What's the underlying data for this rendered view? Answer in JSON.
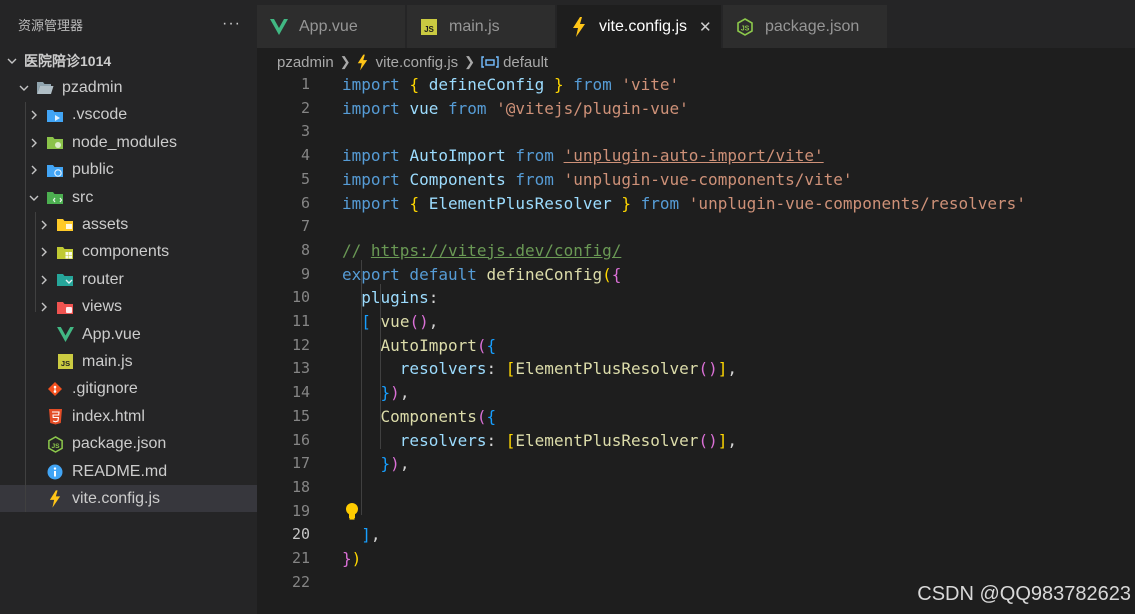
{
  "explorer": {
    "title": "资源管理器",
    "more": "···",
    "tree": [
      {
        "label": "医院陪诊1014",
        "type": "root",
        "chevron": "down",
        "indent": 0
      },
      {
        "label": "pzadmin",
        "type": "folder-open",
        "chevron": "down",
        "indent": 1
      },
      {
        "label": ".vscode",
        "type": "vscode",
        "chevron": "right",
        "indent": 2
      },
      {
        "label": "node_modules",
        "type": "node",
        "chevron": "right",
        "indent": 2
      },
      {
        "label": "public",
        "type": "public",
        "chevron": "right",
        "indent": 2
      },
      {
        "label": "src",
        "type": "src",
        "chevron": "down",
        "indent": 2
      },
      {
        "label": "assets",
        "type": "assets",
        "chevron": "right",
        "indent": 3
      },
      {
        "label": "components",
        "type": "components",
        "chevron": "right",
        "indent": 3
      },
      {
        "label": "router",
        "type": "router",
        "chevron": "right",
        "indent": 3
      },
      {
        "label": "views",
        "type": "views",
        "chevron": "right",
        "indent": 3
      },
      {
        "label": "App.vue",
        "type": "vue",
        "chevron": "",
        "indent": 3
      },
      {
        "label": "main.js",
        "type": "js",
        "chevron": "",
        "indent": 3
      },
      {
        "label": ".gitignore",
        "type": "git",
        "chevron": "",
        "indent": 2
      },
      {
        "label": "index.html",
        "type": "html",
        "chevron": "",
        "indent": 2
      },
      {
        "label": "package.json",
        "type": "json",
        "chevron": "",
        "indent": 2
      },
      {
        "label": "README.md",
        "type": "info",
        "chevron": "",
        "indent": 2
      },
      {
        "label": "vite.config.js",
        "type": "vite",
        "chevron": "",
        "indent": 2,
        "selected": true
      }
    ]
  },
  "tabs": [
    {
      "label": "App.vue",
      "icon": "vue-icon",
      "active": false
    },
    {
      "label": "main.js",
      "icon": "js-icon",
      "active": false
    },
    {
      "label": "vite.config.js",
      "icon": "vite-icon",
      "active": true,
      "close": "✕"
    },
    {
      "label": "package.json",
      "icon": "json-icon",
      "active": false
    }
  ],
  "breadcrumb": {
    "folder": "pzadmin",
    "file": "vite.config.js",
    "symbol": "default"
  },
  "editor": {
    "current_line": 20,
    "lines": [
      {
        "n": 1,
        "tokens": [
          [
            "kw",
            "import "
          ],
          [
            "b1",
            "{ "
          ],
          [
            "id",
            "defineConfig "
          ],
          [
            "b1",
            "}"
          ],
          [
            "kw",
            " from "
          ],
          [
            "str",
            "'vite'"
          ]
        ]
      },
      {
        "n": 2,
        "tokens": [
          [
            "kw",
            "import "
          ],
          [
            "id",
            "vue"
          ],
          [
            "kw",
            " from "
          ],
          [
            "str",
            "'@vitejs/plugin-vue'"
          ]
        ]
      },
      {
        "n": 3,
        "tokens": []
      },
      {
        "n": 4,
        "tokens": [
          [
            "kw",
            "import "
          ],
          [
            "id",
            "AutoImport"
          ],
          [
            "kw",
            " from "
          ],
          [
            "str link",
            "'unplugin-auto-import/vite'"
          ]
        ]
      },
      {
        "n": 5,
        "tokens": [
          [
            "kw",
            "import "
          ],
          [
            "id",
            "Components"
          ],
          [
            "kw",
            " from "
          ],
          [
            "str",
            "'unplugin-vue-components/vite'"
          ]
        ]
      },
      {
        "n": 6,
        "tokens": [
          [
            "kw",
            "import "
          ],
          [
            "b1",
            "{ "
          ],
          [
            "id",
            "ElementPlusResolver "
          ],
          [
            "b1",
            "}"
          ],
          [
            "kw",
            " from "
          ],
          [
            "str",
            "'unplugin-vue-components/resolvers'"
          ]
        ]
      },
      {
        "n": 7,
        "tokens": []
      },
      {
        "n": 8,
        "tokens": [
          [
            "cm",
            "// "
          ],
          [
            "cm link",
            "https://vitejs.dev/config/"
          ]
        ]
      },
      {
        "n": 9,
        "tokens": [
          [
            "kw",
            "export default "
          ],
          [
            "fn",
            "defineConfig"
          ],
          [
            "b1",
            "("
          ],
          [
            "b2",
            "{"
          ]
        ]
      },
      {
        "n": 10,
        "tokens": [
          [
            "plain",
            "  "
          ],
          [
            "id",
            "plugins"
          ],
          [
            "plain",
            ":"
          ]
        ]
      },
      {
        "n": 11,
        "tokens": [
          [
            "plain",
            "  "
          ],
          [
            "b3",
            "["
          ],
          [
            "plain",
            " "
          ],
          [
            "fn",
            "vue"
          ],
          [
            "b2",
            "()"
          ],
          [
            "plain",
            ","
          ]
        ]
      },
      {
        "n": 12,
        "tokens": [
          [
            "plain",
            "    "
          ],
          [
            "fn",
            "AutoImport"
          ],
          [
            "b2",
            "("
          ],
          [
            "b3",
            "{"
          ]
        ]
      },
      {
        "n": 13,
        "tokens": [
          [
            "plain",
            "      "
          ],
          [
            "id",
            "resolvers"
          ],
          [
            "plain",
            ": "
          ],
          [
            "b1",
            "["
          ],
          [
            "fn",
            "ElementPlusResolver"
          ],
          [
            "b2",
            "()"
          ],
          [
            "b1",
            "]"
          ],
          [
            "plain",
            ","
          ]
        ]
      },
      {
        "n": 14,
        "tokens": [
          [
            "plain",
            "    "
          ],
          [
            "b3",
            "}"
          ],
          [
            "b2",
            ")"
          ],
          [
            "plain",
            ","
          ]
        ]
      },
      {
        "n": 15,
        "tokens": [
          [
            "plain",
            "    "
          ],
          [
            "fn",
            "Components"
          ],
          [
            "b2",
            "("
          ],
          [
            "b3",
            "{"
          ]
        ]
      },
      {
        "n": 16,
        "tokens": [
          [
            "plain",
            "      "
          ],
          [
            "id",
            "resolvers"
          ],
          [
            "plain",
            ": "
          ],
          [
            "b1",
            "["
          ],
          [
            "fn",
            "ElementPlusResolver"
          ],
          [
            "b2",
            "()"
          ],
          [
            "b1",
            "]"
          ],
          [
            "plain",
            ","
          ]
        ]
      },
      {
        "n": 17,
        "tokens": [
          [
            "plain",
            "    "
          ],
          [
            "b3",
            "}"
          ],
          [
            "b2",
            ")"
          ],
          [
            "plain",
            ","
          ]
        ]
      },
      {
        "n": 18,
        "tokens": []
      },
      {
        "n": 19,
        "tokens": []
      },
      {
        "n": 20,
        "tokens": [
          [
            "plain",
            "  "
          ],
          [
            "b3",
            "]"
          ],
          [
            "plain",
            ","
          ]
        ]
      },
      {
        "n": 21,
        "tokens": [
          [
            "b2",
            "}"
          ],
          [
            "b1",
            ")"
          ]
        ]
      },
      {
        "n": 22,
        "tokens": []
      }
    ]
  },
  "lightbulb": "lightbulb-icon",
  "watermark": "CSDN @QQ983782623",
  "colors": {
    "keyword": "#569cd6",
    "string": "#ce9178",
    "function": "#dcdcaa",
    "variable": "#9cdcfe",
    "comment": "#6a9955",
    "bracket_gold": "#ffd700",
    "bracket_purple": "#da70d6",
    "bracket_blue": "#179fff"
  }
}
